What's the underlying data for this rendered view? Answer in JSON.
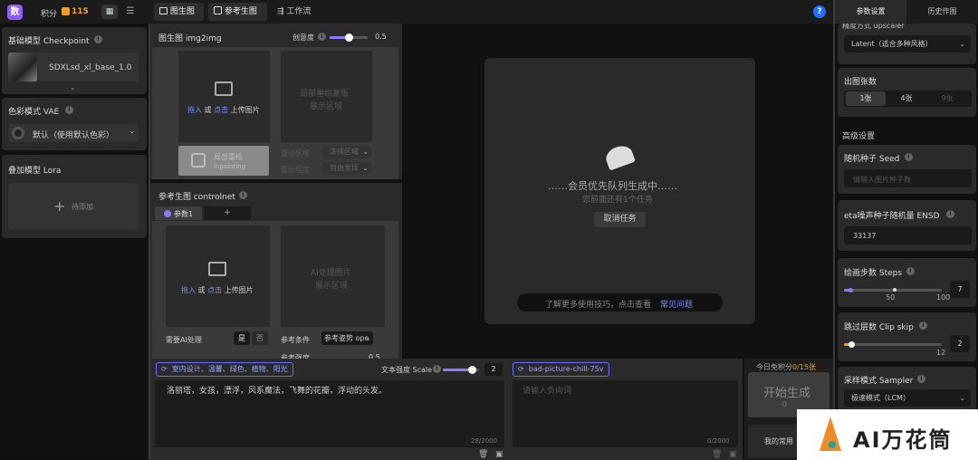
{
  "topbar": {
    "logo_char": "数",
    "points_label": "积分",
    "points_value": "115",
    "tabs": [
      {
        "label": "图生图"
      },
      {
        "label": "参考生图"
      },
      {
        "label": "工作流"
      }
    ],
    "help": "?"
  },
  "left": {
    "checkpoint_title": "基础模型 Checkpoint",
    "checkpoint_name": "SDXLsd_xl_base_1.0",
    "vae_title": "色彩模式 VAE",
    "vae_value": "默认（使用默认色彩）",
    "lora_title": "叠加模型 Lora",
    "lora_add": "待添加"
  },
  "img2img": {
    "title": "图生图 img2img",
    "creativity_label": "创意度",
    "creativity_value": "0.5",
    "creativity_fraction": 0.5,
    "upload_drag": "拖入",
    "upload_or": " 或 ",
    "upload_click": "点击",
    "upload_text": " 上传图片",
    "mask_line1": "局部重绘蒙版",
    "mask_line2": "展示区域",
    "inpaint_line1": "局部重绘",
    "inpaint_line2": "inpainting",
    "redraw_area_label": "重绘区域",
    "redraw_area_value": "涂抹区域",
    "redraw_level_label": "重绘程度",
    "redraw_level_value": "自由发挥"
  },
  "controlnet": {
    "title": "参考生图 controlnet",
    "tab1": "参数1",
    "tab_add": "+",
    "upload_drag": "拖入",
    "upload_or": " 或 ",
    "upload_click": "点击",
    "upload_text": " 上传图片",
    "ai_line1": "AI处理图片",
    "ai_line2": "展示区域",
    "need_ai_label": "需要AI处理",
    "yes": "是",
    "no": "否",
    "condition_label": "参考条件",
    "condition_value": "参考姿势 ope",
    "strength_label": "参考强度",
    "strength_value": "0.5"
  },
  "preview": {
    "queue_text": "……会员优先队列生成中……",
    "ahead_text": "您前面还有1个任务",
    "cancel": "取消任务",
    "tip_text": "了解更多使用技巧，点击查看",
    "tip_link": "常见问题"
  },
  "prompt": {
    "tag": "室内设计、温馨、绿色、植物、阳光",
    "scale_label": "文本强度 Scale",
    "scale_value": "2",
    "scale_fraction": 0.8,
    "text": "洛丽塔，女孩，漂浮，风系魔法，飞舞的花瓣，浮动的头发。",
    "count": "28/2000"
  },
  "negative": {
    "tag": "bad-picture-chill-75v",
    "placeholder": "请输入负向词",
    "count": "0/2000"
  },
  "generate": {
    "free_label": "今日免积分",
    "free_used": "0",
    "free_total": "/15张",
    "button": "开始生成",
    "cost": "-0",
    "common": "我的常用"
  },
  "right": {
    "tabs": [
      {
        "label": "参数设置"
      },
      {
        "label": "历史作图"
      }
    ],
    "upscaler_label": "精度方式 upscaler",
    "upscaler_value": "Latent（适合多种风格）",
    "count_title": "出图张数",
    "count_options": [
      "1张",
      "4张",
      "9张"
    ],
    "advanced": "高级设置",
    "seed_title": "随机种子 Seed",
    "seed_placeholder": "请输入图片种子数",
    "eta_title": "eta噪声种子随机量 ENSD",
    "eta_value": "33137",
    "steps_title": "绘画步数 Steps",
    "steps_value": "7",
    "steps_mid": "50",
    "steps_max": "100",
    "steps_fraction": 0.07,
    "clip_title": "跳过层数 Clip skip",
    "clip_value": "2",
    "clip_max": "12",
    "clip_fraction": 0.08,
    "sampler_title": "采样模式 Sampler",
    "sampler_value": "极速模式（LCM）"
  },
  "watermark": {
    "text": "AI万花筒"
  }
}
